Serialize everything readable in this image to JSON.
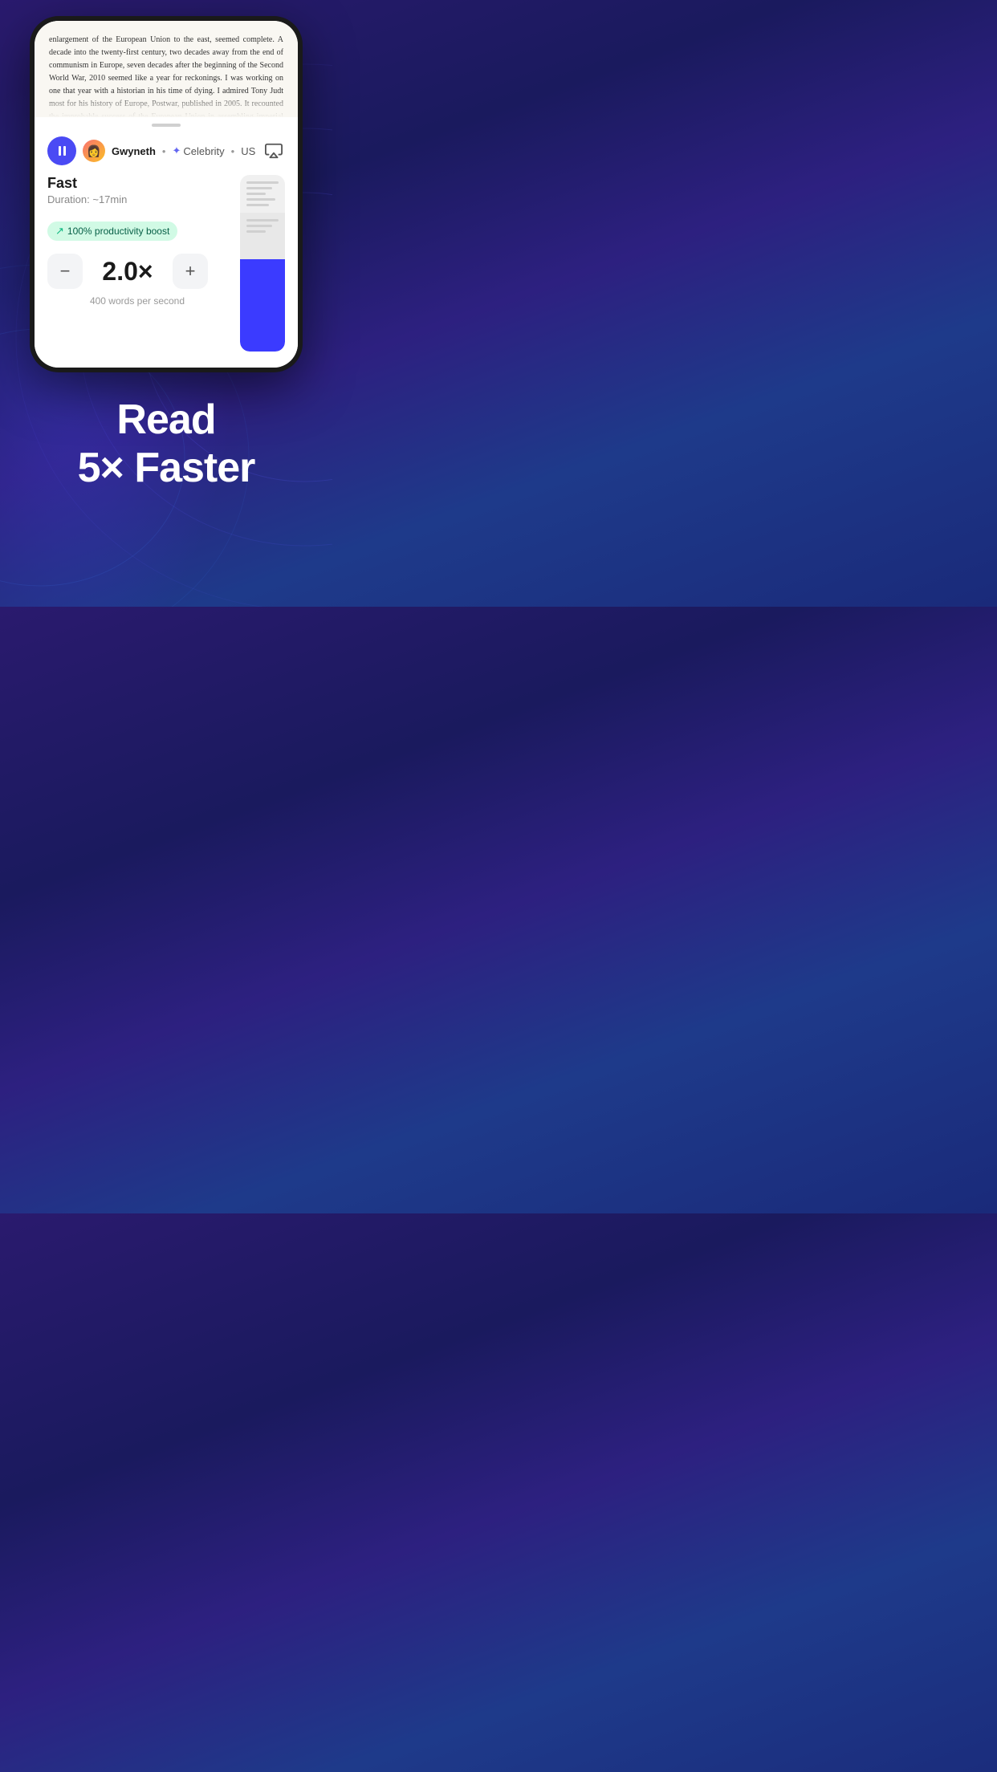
{
  "background": {
    "gradient_start": "#2a1a6e",
    "gradient_end": "#1a2a7a"
  },
  "phone": {
    "book_text": "enlargement of the European Union to the east, seemed complete. A decade into the twenty-first century, two decades away from the end of communism in Europe, seven decades after the beginning of the Second World War, 2010 seemed like a year for reckonings.\n\nI was working on one that year with a historian in his time of dying. I admired Tony Judt most for his history of Europe, Postwar, published in 2005. It recounted the improbable success of the European Union in assembling imperial fragments into the world's larg-"
  },
  "controls": {
    "pause_button": "pause",
    "voice_avatar_emoji": "👩",
    "voice_name": "Gwyneth",
    "dot_separator": "•",
    "voice_type_label": "Celebrity",
    "voice_region": "US",
    "airplay_label": "airplay"
  },
  "speed": {
    "label": "Fast",
    "duration_label": "Duration: ~17min",
    "productivity_badge": "100% productivity boost",
    "speed_value": "2.0×",
    "wps_label": "400 words per second",
    "decrease_btn": "−",
    "increase_btn": "+"
  },
  "tagline": {
    "line1": "Read",
    "line2": "5× Faster"
  }
}
